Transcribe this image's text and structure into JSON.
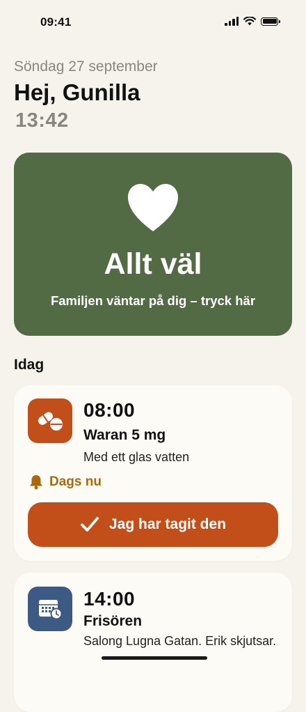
{
  "status_bar": {
    "time": "09:41"
  },
  "header": {
    "date": "Söndag 27 september",
    "greeting": "Hej, Gunilla",
    "clock": "13:42"
  },
  "status_card": {
    "icon": "heart-icon",
    "title": "Allt väl",
    "subtitle": "Familjen väntar på dig – tryck här",
    "color": "#526b45"
  },
  "today": {
    "section_title": "Idag",
    "tasks": [
      {
        "icon": "pill-icon",
        "time": "08:00",
        "title": "Waran 5 mg",
        "description": "Med ett glas vatten",
        "due_label": "Dags nu",
        "button_label": "Jag har tagit den",
        "color": "#c24e19"
      },
      {
        "icon": "calendar-clock-icon",
        "time": "14:00",
        "title": "Frisören",
        "description": "Salong Lugna Gatan. Erik skjutsar.",
        "color": "#3d5a85"
      }
    ]
  }
}
